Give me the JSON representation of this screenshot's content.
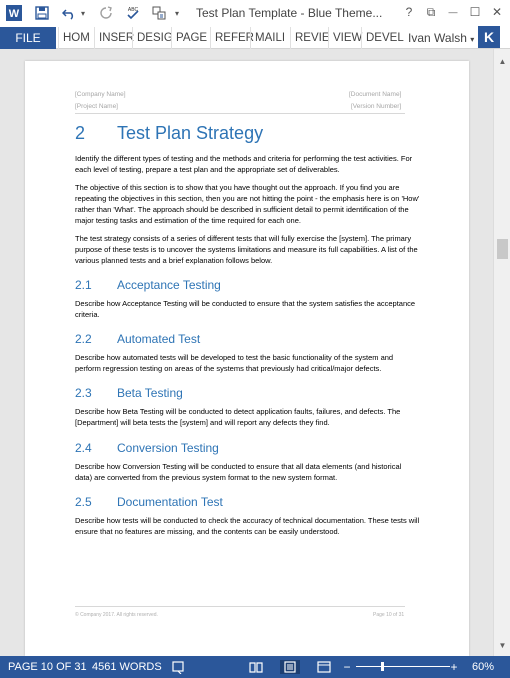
{
  "window": {
    "title": "Test Plan Template - Blue Theme...",
    "help_icon": "?",
    "restore_icon": "⧉",
    "minimize_icon": "—",
    "maximize_icon": "☐",
    "close_icon": "✕"
  },
  "qat": {
    "app_icon": "W",
    "save_icon": "save-icon",
    "undo_icon": "undo-icon",
    "redo_icon": "redo-icon",
    "spelling_icon": "spelling-icon",
    "format_icon": "format-icon",
    "customize_icon": "customize-icon"
  },
  "ribbon": {
    "file": "FILE",
    "tabs": [
      "HOM",
      "INSER",
      "DESIG",
      "PAGE",
      "REFER",
      "MAILI",
      "REVIE",
      "VIEW",
      "DEVEL"
    ],
    "user_name": "Ivan Walsh",
    "user_dropdown_icon": "▾",
    "avatar": "K"
  },
  "document": {
    "header": {
      "company": "[Company Name]",
      "project": "[Project Name]",
      "document": "[Document Name]",
      "version": "[Version Number]"
    },
    "heading1": {
      "num": "2",
      "title": "Test Plan Strategy"
    },
    "paragraphs": [
      "Identify the different types of testing and the methods and criteria for performing the test activities. For each level of testing, prepare a test plan and the appropriate set of deliverables.",
      "The objective of this section is to show that you have thought out the approach. If you find you are repeating the objectives in this section, then you are not hitting the point - the emphasis here is on 'How' rather than 'What'. The approach should be described in sufficient detail to permit identification of the major testing tasks and estimation of the time required for each one.",
      "The test strategy consists of a series of different tests that will fully exercise the [system]. The primary purpose of these tests is to uncover the systems limitations and measure its full capabilities. A list of the various planned tests and a brief explanation follows below."
    ],
    "sections": [
      {
        "num": "2.1",
        "title": "Acceptance Testing",
        "body": "Describe how Acceptance Testing will be conducted to ensure that the system satisfies the acceptance criteria."
      },
      {
        "num": "2.2",
        "title": "Automated Test",
        "body": "Describe how automated tests will be developed to test the basic functionality of the system and perform regression testing on areas of the systems that previously had critical/major defects."
      },
      {
        "num": "2.3",
        "title": "Beta Testing",
        "body": "Describe how Beta Testing will be conducted to detect application faults, failures, and defects. The [Department] will beta tests the [system] and will report any defects they find."
      },
      {
        "num": "2.4",
        "title": "Conversion Testing",
        "body": "Describe how Conversion Testing will be conducted to ensure that all data elements (and historical data) are converted from the previous system format to the new system format."
      },
      {
        "num": "2.5",
        "title": "Documentation Test",
        "body": "Describe how tests will be conducted to check the accuracy of technical documentation. These tests will ensure that no features are missing, and the contents can be easily understood."
      }
    ],
    "footer": {
      "copyright": "© Company 2017. All rights reserved.",
      "page": "Page 10 of 31"
    }
  },
  "status": {
    "page": "PAGE 10 OF 31",
    "words": "4561 WORDS",
    "proofing_icon": "proofing-icon",
    "read_mode_icon": "read-mode-icon",
    "print_layout_icon": "print-layout-icon",
    "web_layout_icon": "web-layout-icon",
    "zoom_minus": "−",
    "zoom_plus": "+",
    "zoom": "60%",
    "zoom_level": 0.6
  },
  "colors": {
    "brand": "#2b579a",
    "heading": "#2e74b5"
  }
}
